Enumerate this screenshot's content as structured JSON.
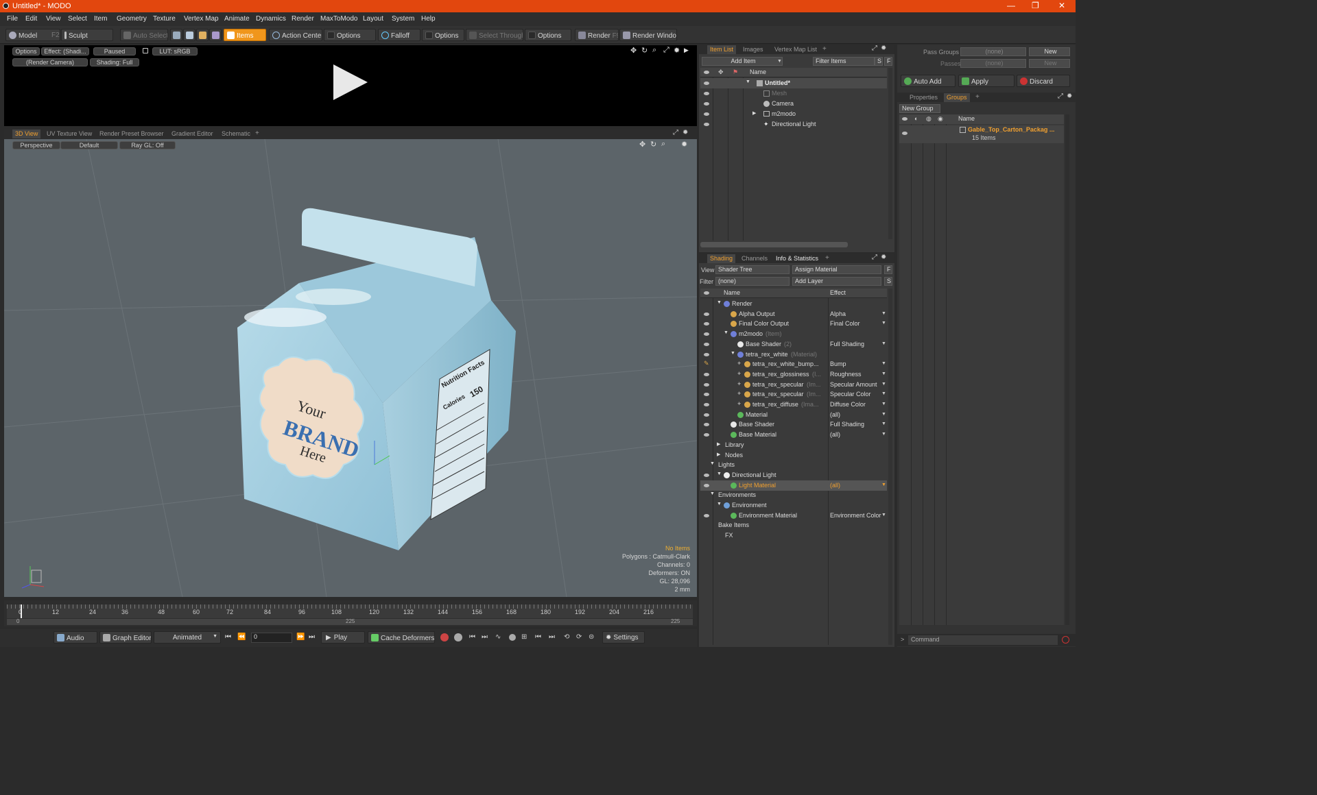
{
  "window": {
    "title": "Untitled* - MODO"
  },
  "menu": [
    "File",
    "Edit",
    "View",
    "Select",
    "Item",
    "Geometry",
    "Texture",
    "Vertex Map",
    "Animate",
    "Dynamics",
    "Render",
    "MaxToModo",
    "Layout",
    "System",
    "Help"
  ],
  "toolbar": {
    "model": "Model",
    "model_key": "F2",
    "sculpt": "Sculpt",
    "auto_select": "Auto Select",
    "items": "Items",
    "action_center": "Action Center",
    "options1": "Options",
    "falloff": "Falloff",
    "options2": "Options",
    "select_through": "Select Through",
    "options3": "Options",
    "render": "Render",
    "render_key": "F9",
    "render_window": "Render Window"
  },
  "preview": {
    "options": "Options",
    "effect": "Effect: (Shadi...",
    "paused": "Paused",
    "lut": "LUT: sRGB",
    "camera": "(Render Camera)",
    "shading": "Shading: Full"
  },
  "view_tabs": [
    "3D View",
    "UV Texture View",
    "Render Preset Browser",
    "Gradient Editor",
    "Schematic"
  ],
  "viewport": {
    "perspective": "Perspective",
    "default": "Default",
    "raygl": "Ray GL: Off",
    "status": [
      "No Items",
      "Polygons : Catmull-Clark",
      "Channels: 0",
      "Deformers: ON",
      "GL: 28,096",
      "2 mm"
    ],
    "carton_text": {
      "your": "Your",
      "brand": "BRAND",
      "here": "Here",
      "nutrition": "Nutrition Facts",
      "calories": "Calories",
      "cal_value": "150"
    }
  },
  "timeline": {
    "ticks": [
      "0",
      "12",
      "24",
      "36",
      "48",
      "60",
      "72",
      "84",
      "96",
      "108",
      "120",
      "132",
      "144",
      "156",
      "168",
      "180",
      "192",
      "204",
      "216"
    ],
    "start": "0",
    "mid": "225",
    "end": "225"
  },
  "bottombar": {
    "audio": "Audio",
    "graph_editor": "Graph Editor",
    "animated": "Animated",
    "frame": "0",
    "play": "Play",
    "cache_deformers": "Cache Deformers",
    "settings": "Settings"
  },
  "itemlist": {
    "tabs": [
      "Item List",
      "Images",
      "Vertex Map List"
    ],
    "add_item": "Add Item",
    "filter_items": "Filter Items",
    "s": "S",
    "f": "F",
    "name_header": "Name",
    "items": [
      "Untitled*",
      "Mesh",
      "Camera",
      "m2modo",
      "Directional Light"
    ]
  },
  "shading": {
    "tabs": [
      "Shading",
      "Channels",
      "Info & Statistics"
    ],
    "view_label": "View",
    "view_value": "Shader Tree",
    "assign_material": "Assign Material",
    "filter_label": "Filter",
    "filter_value": "(none)",
    "add_layer": "Add Layer",
    "name_header": "Name",
    "effect_header": "Effect",
    "rows": [
      {
        "name": "Render",
        "sub": "",
        "effect": ""
      },
      {
        "name": "Alpha Output",
        "sub": "",
        "effect": "Alpha"
      },
      {
        "name": "Final Color Output",
        "sub": "",
        "effect": "Final Color"
      },
      {
        "name": "m2modo",
        "sub": "(Item)",
        "effect": ""
      },
      {
        "name": "Base Shader",
        "sub": "(2)",
        "effect": "Full Shading"
      },
      {
        "name": "tetra_rex_white",
        "sub": "(Material)",
        "effect": ""
      },
      {
        "name": "tetra_rex_white_bump...",
        "sub": "",
        "effect": "Bump"
      },
      {
        "name": "tetra_rex_glossiness",
        "sub": "(I...",
        "effect": "Roughness"
      },
      {
        "name": "tetra_rex_specular",
        "sub": "(Im...",
        "effect": "Specular Amount"
      },
      {
        "name": "tetra_rex_specular",
        "sub": "(Im...",
        "effect": "Specular Color"
      },
      {
        "name": "tetra_rex_diffuse",
        "sub": "(Ima...",
        "effect": "Diffuse Color"
      },
      {
        "name": "Material",
        "sub": "",
        "effect": "(all)"
      },
      {
        "name": "Base Shader",
        "sub": "",
        "effect": "Full Shading"
      },
      {
        "name": "Base Material",
        "sub": "",
        "effect": "(all)"
      },
      {
        "name": "Library",
        "sub": "",
        "effect": ""
      },
      {
        "name": "Nodes",
        "sub": "",
        "effect": ""
      },
      {
        "name": "Lights",
        "sub": "",
        "effect": ""
      },
      {
        "name": "Directional Light",
        "sub": "",
        "effect": ""
      },
      {
        "name": "Light Material",
        "sub": "",
        "effect": "(all)"
      },
      {
        "name": "Environments",
        "sub": "",
        "effect": ""
      },
      {
        "name": "Environment",
        "sub": "",
        "effect": ""
      },
      {
        "name": "Environment Material",
        "sub": "",
        "effect": "Environment Color"
      },
      {
        "name": "Bake Items",
        "sub": "",
        "effect": ""
      },
      {
        "name": "FX",
        "sub": "",
        "effect": ""
      }
    ]
  },
  "right": {
    "pass_groups": "Pass Groups",
    "passes": "Passes",
    "none1": "(none)",
    "none2": "(none)",
    "new1": "New",
    "new2": "New",
    "auto_add": "Auto Add",
    "apply": "Apply",
    "discard": "Discard",
    "tabs": [
      "Properties",
      "Groups"
    ],
    "new_group": "New Group",
    "name_header": "Name",
    "group_name": "Gable_Top_Carton_Packag ...",
    "group_count": "15 Items",
    "command": "Command"
  }
}
